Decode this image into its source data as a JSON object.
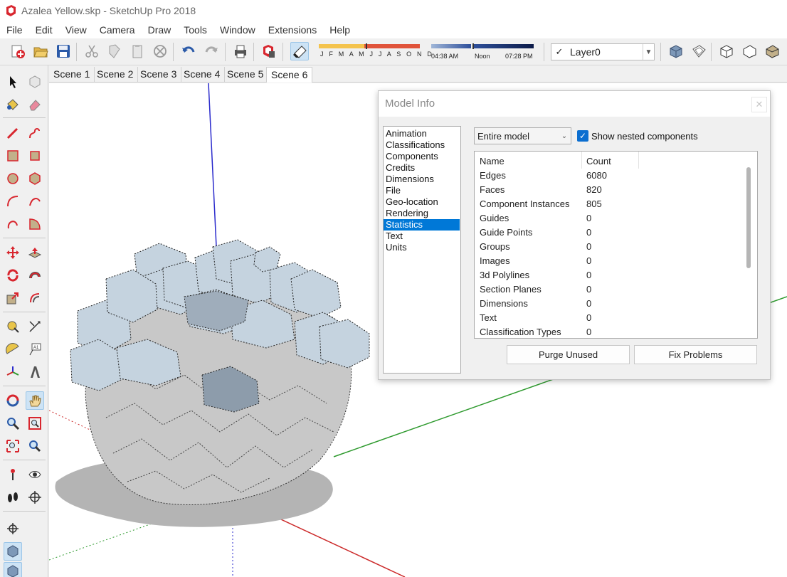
{
  "window": {
    "title": "Azalea Yellow.skp - SketchUp Pro 2018",
    "app_icon": "sketchup-icon"
  },
  "menu": [
    "File",
    "Edit",
    "View",
    "Camera",
    "Draw",
    "Tools",
    "Window",
    "Extensions",
    "Help"
  ],
  "toolbar": {
    "shadow_months": "J F M A M J J A S O N D",
    "time_start": "04:38 AM",
    "time_noon": "Noon",
    "time_end": "07:28 PM",
    "layer_check": "✓",
    "layer_name": "Layer0"
  },
  "scenes": [
    "Scene 1",
    "Scene 2",
    "Scene 3",
    "Scene 4",
    "Scene 5",
    "Scene 6"
  ],
  "active_scene": "Scene 6",
  "model_info": {
    "title": "Model Info",
    "close_glyph": "✕",
    "categories": [
      "Animation",
      "Classifications",
      "Components",
      "Credits",
      "Dimensions",
      "File",
      "Geo-location",
      "Rendering",
      "Statistics",
      "Text",
      "Units"
    ],
    "selected_category": "Statistics",
    "scope": "Entire model",
    "show_nested_label": "Show nested components",
    "show_nested_checked": true,
    "columns": {
      "name": "Name",
      "count": "Count"
    },
    "rows": [
      {
        "name": "Edges",
        "count": "6080"
      },
      {
        "name": "Faces",
        "count": "820"
      },
      {
        "name": "Component Instances",
        "count": "805"
      },
      {
        "name": "Guides",
        "count": "0"
      },
      {
        "name": "Guide Points",
        "count": "0"
      },
      {
        "name": "Groups",
        "count": "0"
      },
      {
        "name": "Images",
        "count": "0"
      },
      {
        "name": "3d Polylines",
        "count": "0"
      },
      {
        "name": "Section Planes",
        "count": "0"
      },
      {
        "name": "Dimensions",
        "count": "0"
      },
      {
        "name": "Text",
        "count": "0"
      },
      {
        "name": "Classification Types",
        "count": "0"
      }
    ],
    "purge_label": "Purge Unused",
    "fix_label": "Fix Problems"
  },
  "colors": {
    "selection": "#0078d7",
    "axis_red": "#cc2a2a",
    "axis_green": "#2e9a2e",
    "axis_blue": "#2a2acc",
    "petal": "#c5d3df"
  }
}
